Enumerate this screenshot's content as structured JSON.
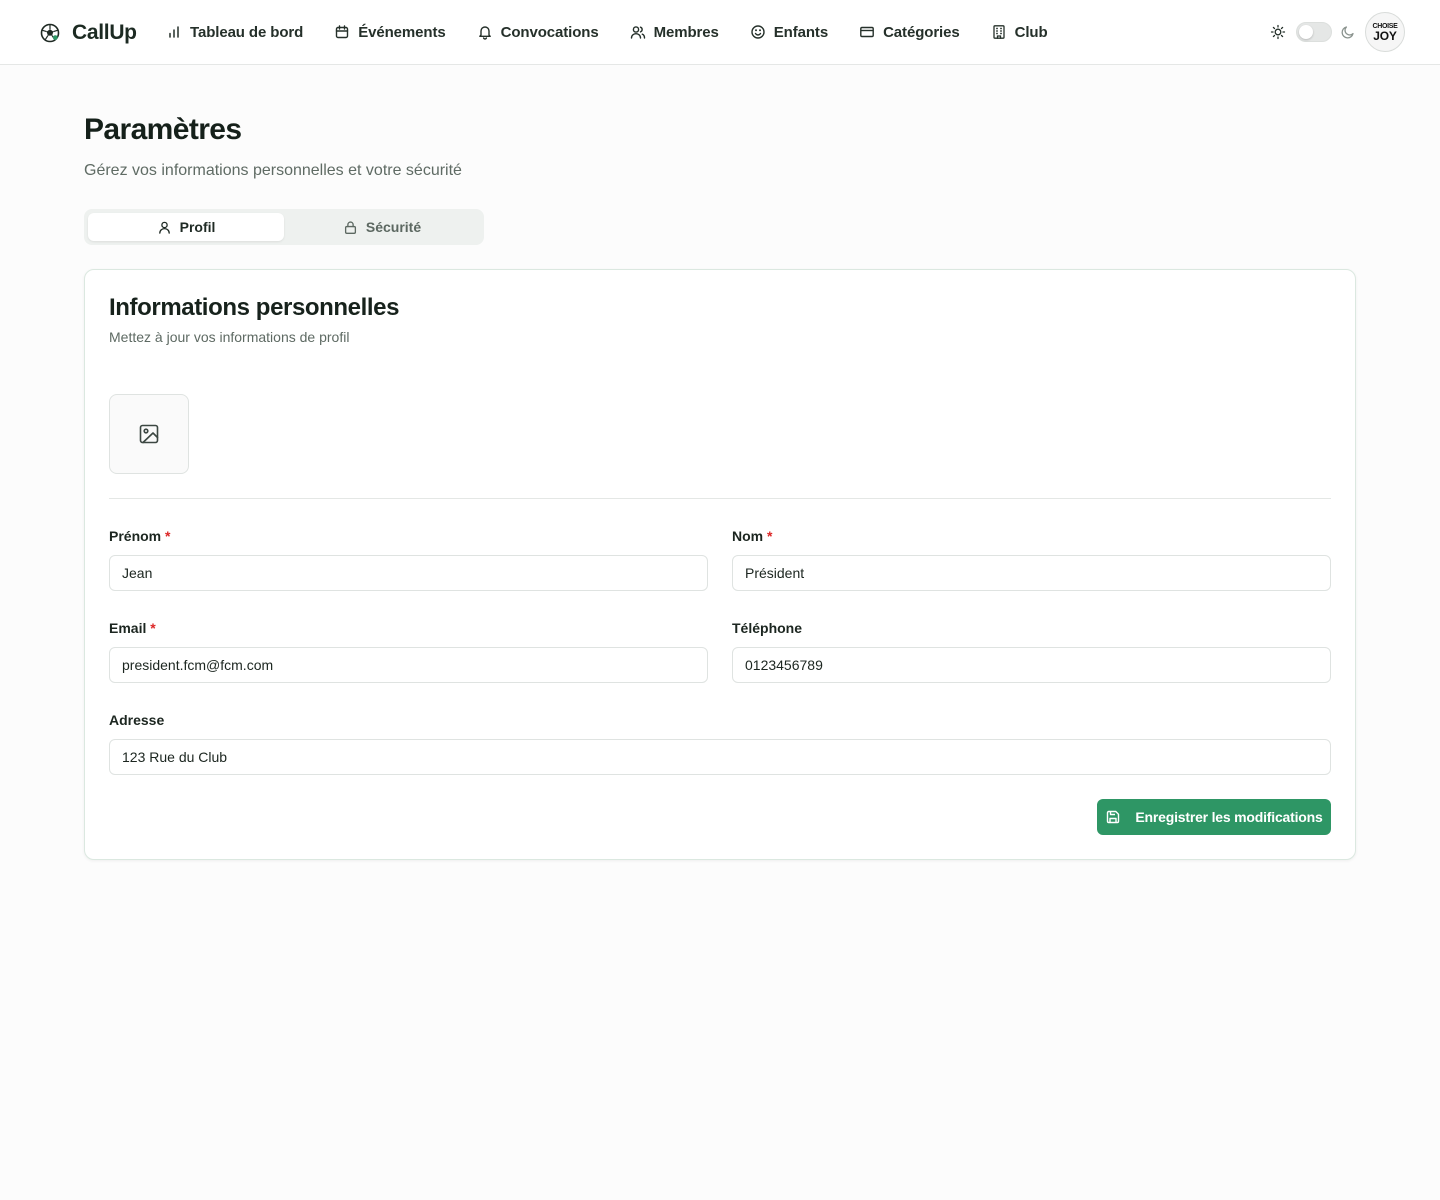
{
  "app": {
    "name": "CallUp",
    "logo_icon": "soccer-ball-icon"
  },
  "nav": {
    "items": [
      {
        "label": "Tableau de bord",
        "icon": "bar-chart-icon"
      },
      {
        "label": "Événements",
        "icon": "calendar-icon"
      },
      {
        "label": "Convocations",
        "icon": "bell-icon"
      },
      {
        "label": "Membres",
        "icon": "users-icon"
      },
      {
        "label": "Enfants",
        "icon": "smile-icon"
      },
      {
        "label": "Catégories",
        "icon": "card-icon"
      },
      {
        "label": "Club",
        "icon": "building-icon"
      }
    ]
  },
  "theme": {
    "light_icon": "sun-icon",
    "dark_icon": "moon-icon",
    "dark_mode": false
  },
  "user": {
    "avatar_top": "CHOISE",
    "avatar_bottom": "JOY"
  },
  "page": {
    "title": "Paramètres",
    "subtitle": "Gérez vos informations personnelles et votre sécurité"
  },
  "tabs": [
    {
      "label": "Profil",
      "icon": "user-icon",
      "active": true
    },
    {
      "label": "Sécurité",
      "icon": "lock-icon",
      "active": false
    }
  ],
  "card": {
    "title": "Informations personnelles",
    "description": "Mettez à jour vos informations de profil",
    "image_icon": "image-icon"
  },
  "form": {
    "first_name": {
      "label": "Prénom",
      "required_mark": "*",
      "value": "Jean"
    },
    "last_name": {
      "label": "Nom",
      "required_mark": "*",
      "value": "Président"
    },
    "email": {
      "label": "Email",
      "required_mark": "*",
      "value": "president.fcm@fcm.com"
    },
    "phone": {
      "label": "Téléphone",
      "value": "0123456789"
    },
    "address": {
      "label": "Adresse",
      "value": "123 Rue du Club"
    },
    "save_label": "Enregistrer les modifications",
    "save_icon": "save-icon"
  },
  "colors": {
    "accent": "#2e9665",
    "required": "#dc2626",
    "card_border": "#dbe8e0"
  }
}
